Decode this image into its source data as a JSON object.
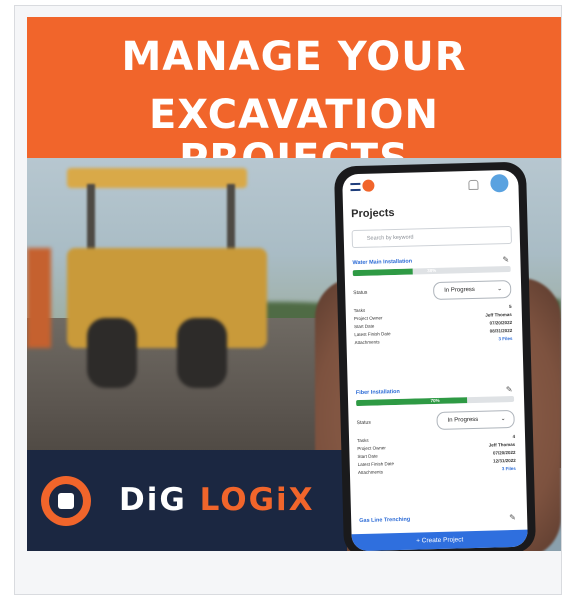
{
  "banner": {
    "line1": "MANAGE YOUR",
    "line2": "EXCAVATION PROJECTS"
  },
  "brand": {
    "part1": "DiG ",
    "part2": "LOGiX",
    "accent_color": "#f1652b",
    "navy_color": "#1b2741"
  },
  "app": {
    "title": "Projects",
    "search_placeholder": "Search by keyword",
    "create_button": "+ Create Project",
    "projects": [
      {
        "name": "Water Main Installation",
        "progress_percent": 38,
        "progress_label": "38%",
        "status_label": "Status",
        "status_value": "In Progress",
        "rows": [
          {
            "label": "Tasks",
            "value": "5"
          },
          {
            "label": "Project Owner",
            "value": "Jeff Thomas"
          },
          {
            "label": "Start Date",
            "value": "07/20/2022"
          },
          {
            "label": "Latest Finish Date",
            "value": "08/31/2022"
          },
          {
            "label": "Attachments",
            "value": "3 Files"
          }
        ]
      },
      {
        "name": "Fiber Installation",
        "progress_percent": 70,
        "progress_label": "70%",
        "status_label": "Status",
        "status_value": "In Progress",
        "rows": [
          {
            "label": "Tasks",
            "value": "4"
          },
          {
            "label": "Project Owner",
            "value": "Jeff Thomas"
          },
          {
            "label": "Start Date",
            "value": "07/20/2022"
          },
          {
            "label": "Latest Finish Date",
            "value": "12/31/2022"
          },
          {
            "label": "Attachments",
            "value": "3 Files"
          }
        ]
      },
      {
        "name": "Gas Line Trenching"
      }
    ]
  }
}
